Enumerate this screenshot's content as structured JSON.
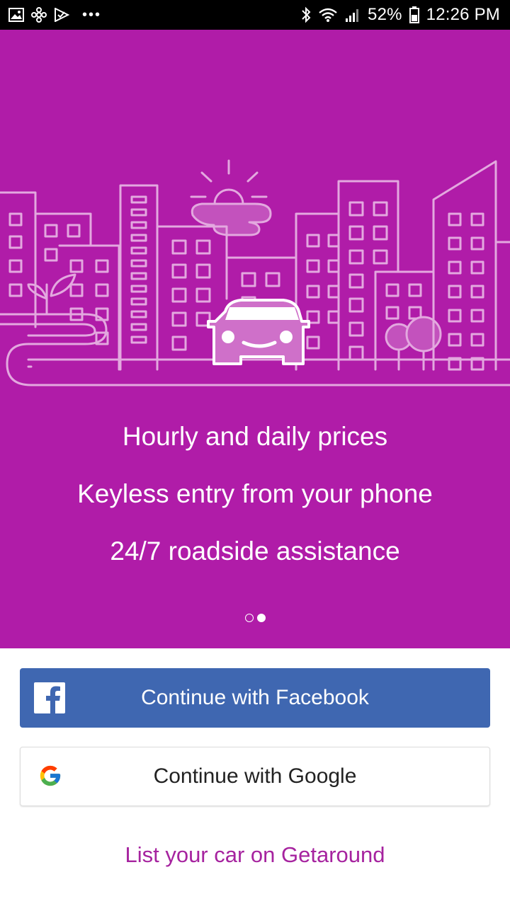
{
  "status_bar": {
    "battery_percent": "52%",
    "time": "12:26 PM",
    "left_icons": [
      "gallery-icon",
      "pinwheel-icon",
      "check-flag-icon",
      "more-dots-icon"
    ],
    "right_icons": [
      "bluetooth-icon",
      "wifi-icon",
      "signal-icon",
      "battery-icon"
    ]
  },
  "hero": {
    "background_color": "#b01ca8",
    "illustration": "city-with-car-illustration",
    "features": [
      "Hourly and daily prices",
      "Keyless entry from your phone",
      "24/7 roadside assistance"
    ],
    "pager": {
      "total_pages": 2,
      "active_page": 2
    }
  },
  "auth": {
    "facebook_label": "Continue with Facebook",
    "facebook_color": "#3f67b1",
    "google_label": "Continue with Google"
  },
  "footer": {
    "list_car_label": "List your car on Getaround",
    "link_color": "#a6239f"
  }
}
